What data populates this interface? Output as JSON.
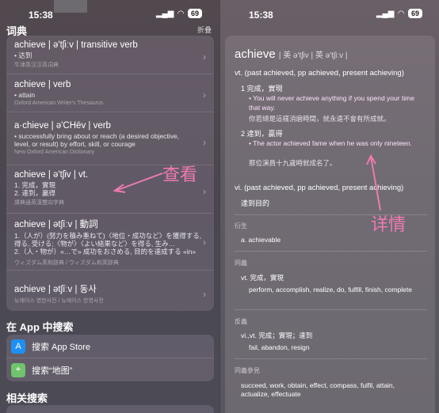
{
  "status": {
    "time": "15:38",
    "battery": "69"
  },
  "left": {
    "dict_title": "词典",
    "collapse": "折叠",
    "entries": [
      {
        "title": "achieve | ə'tʃiːv | transitive verb",
        "body": "• 达到",
        "source": "牛津英汉汉英词典"
      },
      {
        "title": "achieve | verb",
        "body": "• attain",
        "source": "Oxford American Writer's Thesaurus"
      },
      {
        "title": "a·chieve | ə'CHēv | verb",
        "body": "• successfully bring about or reach (a desired objective, level, or result) by effort, skill, or courage",
        "source": "New Oxford American Dictionary"
      },
      {
        "title": "achieve | ə'tʃiv | vt.",
        "body": "1. 完成，實現\n2. 達到，贏得",
        "source": "譯典通英漢雙向字典"
      },
      {
        "title": "achieve | ətʃíːv | 動詞",
        "body": "1.（人が）(努力を積み重ねて)〈地位・成功など〉を獲得する, 得る, 受ける;〈物が〉〈よい結果など〉を得る, 生み…\n2.（人・物が）«…で» 成功をおさめる, 目的を達成する «in»",
        "source": "ウィズダム英和辞典 / ウィズダム和英辞典"
      },
      {
        "title": "achieve | ətʃíːv | 동사",
        "body": "",
        "source": "뉴에이스 영한사전 / 뉴에이스 한영사전"
      }
    ],
    "app_search_title": "在 App 中搜索",
    "search_app_store": "搜索 App Store",
    "search_maps": "搜索“地图”",
    "related_title": "相关搜索",
    "annotation": "查看"
  },
  "right": {
    "word": "achieve",
    "ipa": "| 美 ə'tʃiv | 英 ə'tʃiːv |",
    "vt_line": "vt. (past achieved, pp achieved, present achieving)",
    "sense1": "1 完成，實現",
    "ex1": "• You will never achieve anything if you spend your time that way.",
    "tr1": "你若總是這樣消磨時間，就永遠不會有所成就。",
    "sense2": "2 達到，贏得",
    "ex2": "• The actor achieved fame when he was only nineteen.",
    "tr2": "那位演員十九歲時就成名了。",
    "vi_line": "vi. (past achieved, pp achieved, present achieving)",
    "vi_sense": "達到目的",
    "derived_label": "衍生",
    "derived": "a. achievable",
    "syn_label": "同義",
    "syn_head": "vt. 完成，實現",
    "syn_list": "perform, accomplish, realize, do, fulfill, finish, complete",
    "ant_label": "反義",
    "ant_head": "vi.,vt. 完成；實現；達到",
    "ant_list": "fail, abandon, resign",
    "see_label": "同義參見",
    "see_list": "succeed, work, obtain, effect, compass, fulfil, attain, actualize, effectuate",
    "annotation": "详情"
  }
}
